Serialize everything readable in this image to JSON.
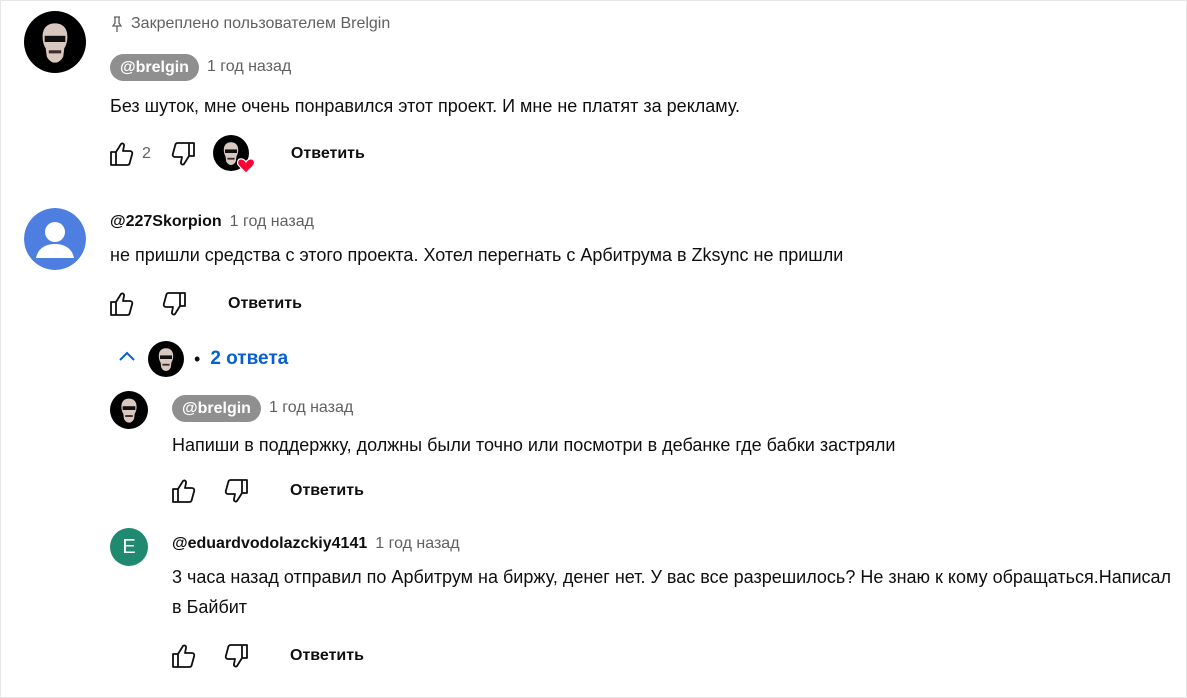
{
  "comments": [
    {
      "pinned_label": "Закреплено пользователем Brelgin",
      "author": "@brelgin",
      "time": "1 год назад",
      "text": "Без шуток, мне очень понравился этот проект. И мне не платят за рекламу.",
      "likes": "2",
      "reply_label": "Ответить"
    },
    {
      "author": "@227Skorpion",
      "time": "1 год назад",
      "text": "не пришли средства с этого проекта. Хотел перегнать с Арбитрума в Zksync не пришли",
      "reply_label": "Ответить",
      "replies_toggle": {
        "dot": "•",
        "label": "2 ответа"
      },
      "replies": [
        {
          "author": "@brelgin",
          "time": "1 год назад",
          "text": "Напиши в поддержку, должны были точно или посмотри в дебанке где бабки застряли",
          "reply_label": "Ответить"
        },
        {
          "author": "@eduardvodolazckiy4141",
          "avatar_letter": "E",
          "avatar_color": "#1f8a70",
          "time": "1 год назад",
          "text": "3 часа назад отправил по Арбитрум на биржу, денег нет. У вас все разрешилось? Не знаю к кому обращаться.Написал в Байбит",
          "reply_label": "Ответить"
        }
      ]
    }
  ],
  "icons": {
    "pin": "pin-icon",
    "like": "thumb-up-icon",
    "dislike": "thumb-down-icon",
    "heart": "heart-icon",
    "chevron": "chevron-up-icon"
  },
  "colors": {
    "link_blue": "#065fd4",
    "heart_red": "#ff0033",
    "default_avatar": "#4e7fe0"
  }
}
